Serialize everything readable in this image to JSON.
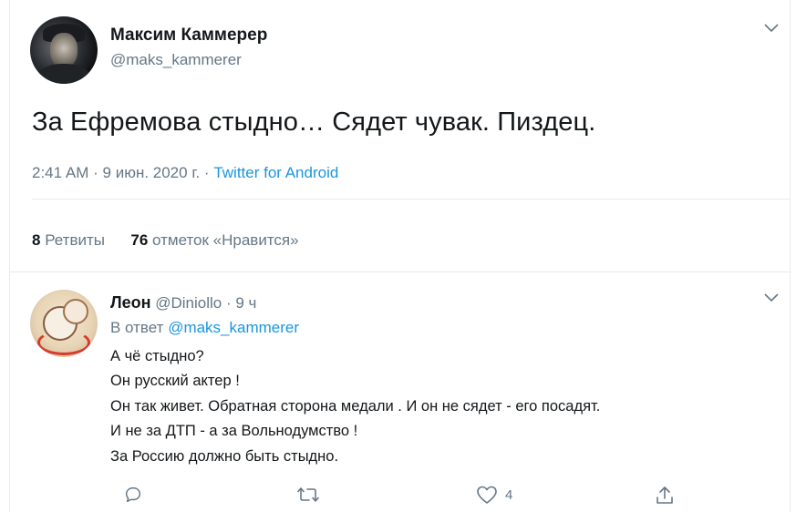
{
  "tweet": {
    "author_name": "Максим Каммерер",
    "author_handle": "@maks_kammerer",
    "text": "За Ефремова стыдно… Сядет чувак. Пиздец.",
    "time": "2:41 AM",
    "date": "9 июн. 2020 г.",
    "meta_sep": "·",
    "source": "Twitter for Android",
    "retweets_count": "8",
    "retweets_label": "Ретвиты",
    "likes_count": "76",
    "likes_label": "отметок «Нравится»"
  },
  "reply": {
    "author_name": "Леон",
    "author_handle": "@Diniollo",
    "age": "· 9 ч",
    "reply_to_prefix": "В ответ",
    "reply_to_handle": "@maks_kammerer",
    "lines": [
      "А чё стыдно?",
      "Он русский актер !",
      "Он так живет. Обратная сторона медали . И он не сядет - его посадят.",
      "И не за ДТП - а за Вольнодумство !",
      "За Россию должно быть стыдно."
    ],
    "like_count": "4"
  },
  "icons": {
    "more": "chevron-down-icon",
    "reply": "reply-icon",
    "retweet": "retweet-icon",
    "like": "heart-icon",
    "share": "share-icon"
  },
  "colors": {
    "link": "#1b95e0",
    "secondary_text": "#657786",
    "primary_text": "#14171a",
    "divider": "#e6ecf0"
  }
}
